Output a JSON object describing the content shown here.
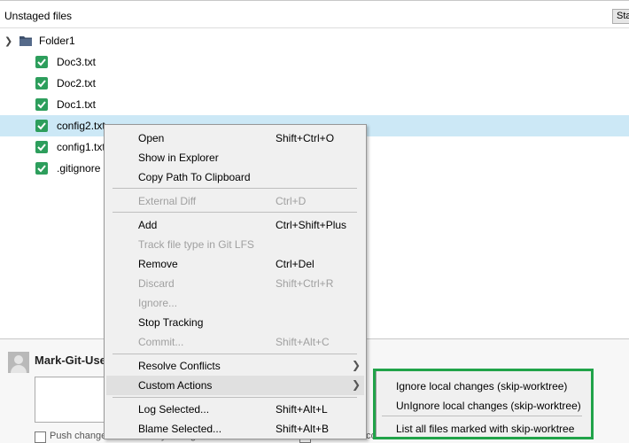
{
  "header": {
    "title": "Unstaged files",
    "stage_label": "Stage"
  },
  "tree": {
    "folder": "Folder1",
    "files": [
      "Doc3.txt",
      "Doc2.txt",
      "Doc1.txt",
      "config2.txt",
      "config1.txt",
      ".gitignore"
    ],
    "selected_file": "config2.txt"
  },
  "commit": {
    "username": "Mark-Git-User",
    "push_label": "Push changes immediately to origin/master",
    "amend_label": "Amend last commit"
  },
  "context_menu": {
    "open": {
      "label": "Open",
      "shortcut": "Shift+Ctrl+O"
    },
    "show_explorer": {
      "label": "Show in Explorer"
    },
    "copy_path": {
      "label": "Copy Path To Clipboard"
    },
    "external_diff": {
      "label": "External Diff",
      "shortcut": "Ctrl+D"
    },
    "add": {
      "label": "Add",
      "shortcut": "Ctrl+Shift+Plus"
    },
    "track_lfs": {
      "label": "Track file type in Git LFS"
    },
    "remove": {
      "label": "Remove",
      "shortcut": "Ctrl+Del"
    },
    "discard": {
      "label": "Discard",
      "shortcut": "Shift+Ctrl+R"
    },
    "ignore": {
      "label": "Ignore..."
    },
    "stop_tracking": {
      "label": "Stop Tracking"
    },
    "commit": {
      "label": "Commit...",
      "shortcut": "Shift+Alt+C"
    },
    "resolve_conflicts": {
      "label": "Resolve Conflicts"
    },
    "custom_actions": {
      "label": "Custom Actions"
    },
    "log_selected": {
      "label": "Log Selected...",
      "shortcut": "Shift+Alt+L"
    },
    "blame_selected": {
      "label": "Blame Selected...",
      "shortcut": "Shift+Alt+B"
    }
  },
  "submenu": {
    "ignore_local": "Ignore local changes (skip-worktree)",
    "unignore_local": "UnIgnore local changes (skip-worktree)",
    "list_all": "List all files marked with skip-worktree"
  },
  "colors": {
    "accent_green": "#21a349",
    "checkbox_green": "#2d9e5c",
    "selection": "#cce8f6"
  }
}
